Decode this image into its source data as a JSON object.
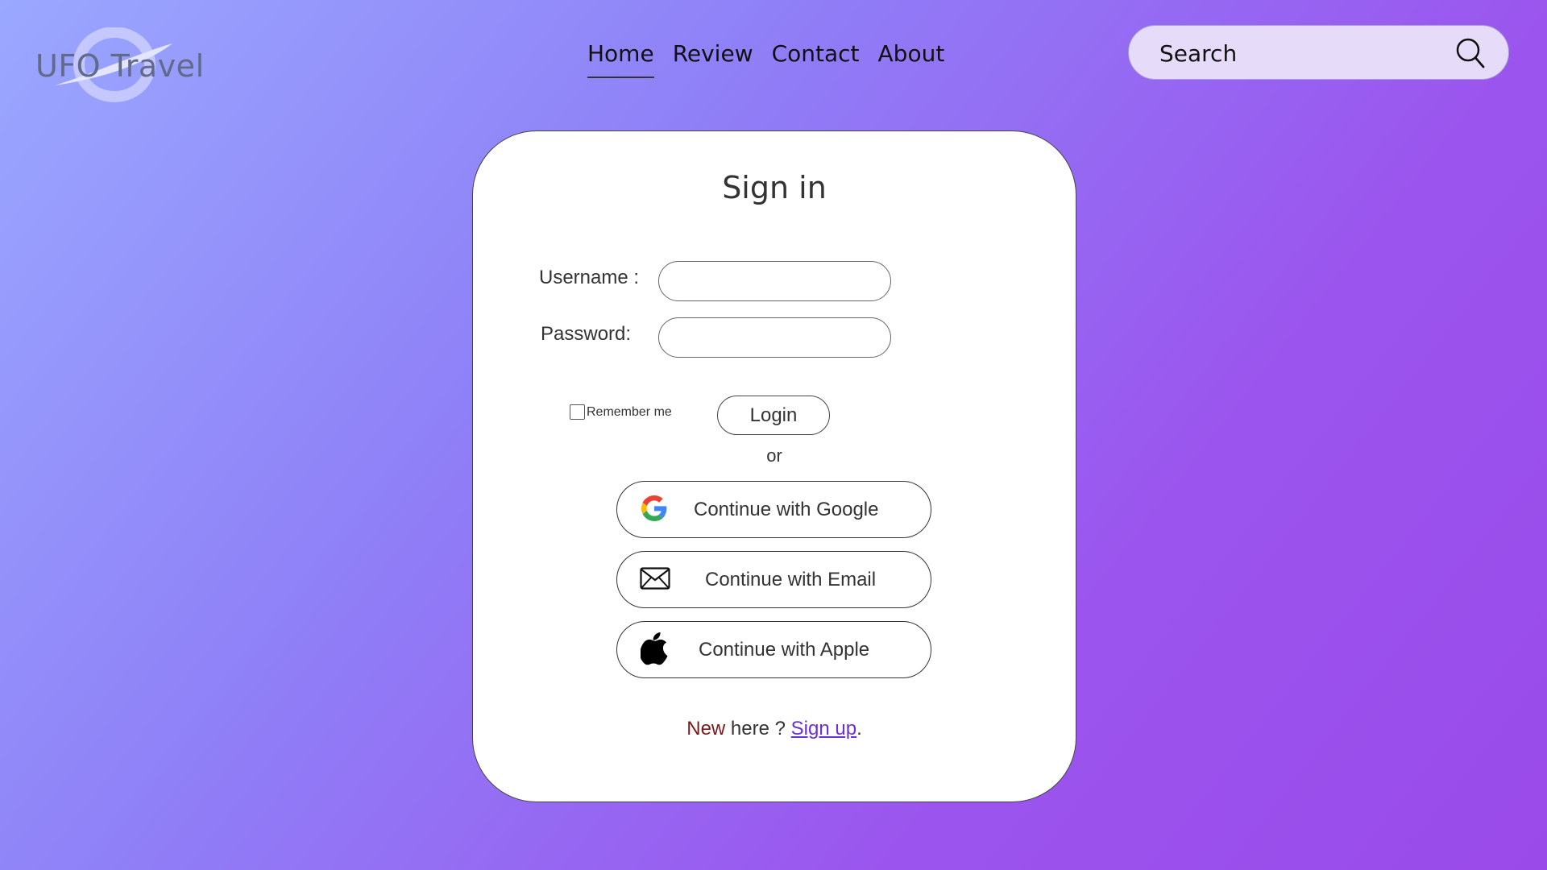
{
  "header": {
    "logo_text": "UFO Travel",
    "nav": [
      {
        "label": "Home",
        "active": true
      },
      {
        "label": "Review",
        "active": false
      },
      {
        "label": "Contact",
        "active": false
      },
      {
        "label": "About",
        "active": false
      }
    ],
    "search": {
      "placeholder": "Search",
      "icon": "search-icon"
    }
  },
  "signin": {
    "title": "Sign in",
    "username_label": "Username :",
    "password_label": "Password:",
    "username_value": "",
    "password_value": "",
    "remember_label": "Remember me",
    "remember_checked": false,
    "login_label": "Login",
    "or_text": "or",
    "social": [
      {
        "label": "Continue with Google",
        "icon": "google-icon"
      },
      {
        "label": "Continue with Email",
        "icon": "mail-icon"
      },
      {
        "label": "Continue with Apple",
        "icon": "apple-icon"
      }
    ],
    "signup_prompt_new": "New",
    "signup_prompt_here": " here ? ",
    "signup_link": "Sign up",
    "signup_end": "."
  },
  "colors": {
    "gradient_start": "#9aa8ff",
    "gradient_end": "#9a4ae9",
    "card_bg": "#ffffff",
    "search_bg": "#e6dcfa",
    "link": "#6a2fd8",
    "new_word": "#7a1a1a"
  }
}
